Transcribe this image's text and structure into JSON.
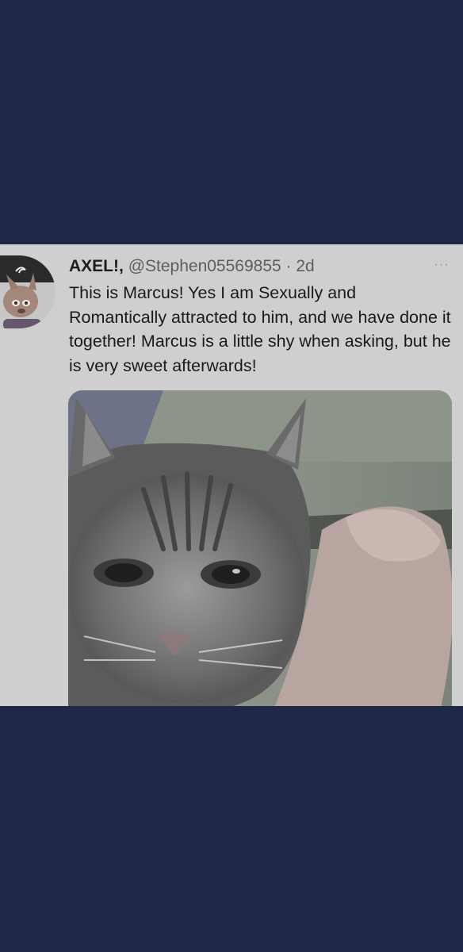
{
  "tweet": {
    "display_name": "AXEL!,",
    "handle": "@Stephen05569855",
    "separator": "·",
    "time": "2d",
    "more_label": "···",
    "text": "This is Marcus! Yes I am Sexually and Romantically attracted to him, and we have done it together! Marcus is a little shy when asking, but he is very sweet afterwards!"
  },
  "colors": {
    "background": "#202645",
    "card": "#cfcfcf",
    "text": "#1a1a1a",
    "muted_text": "#5d5d5d"
  },
  "icons": {
    "more": "more-horizontal-icon",
    "avatar": "cartoon-fox-avatar"
  }
}
